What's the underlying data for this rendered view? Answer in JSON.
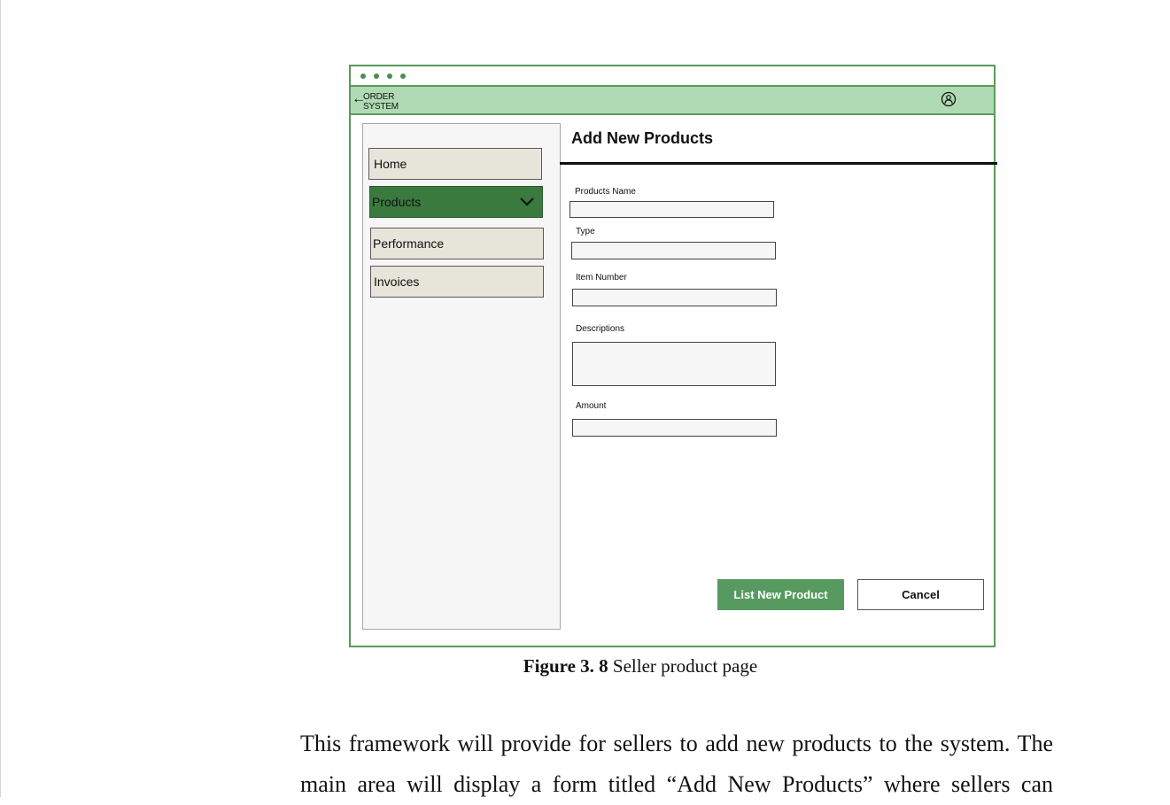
{
  "app": {
    "name_line1": "ORDER",
    "name_line2": "SYSTEM",
    "back_icon": "back-arrow-icon",
    "user_icon": "user-icon"
  },
  "sidebar": {
    "items": [
      {
        "label": "Home"
      },
      {
        "label": "Products",
        "active": true,
        "icon": "chevron-down-icon"
      },
      {
        "label": "Performance"
      },
      {
        "label": "Invoices"
      }
    ]
  },
  "form": {
    "title": "Add New Products",
    "fields": [
      {
        "label": "Products Name",
        "value": ""
      },
      {
        "label": "Type",
        "value": ""
      },
      {
        "label": "Item Number",
        "value": ""
      },
      {
        "label": "Descriptions",
        "value": ""
      },
      {
        "label": "Amount",
        "value": ""
      }
    ],
    "submit_label": "List New Product",
    "cancel_label": "Cancel"
  },
  "caption": {
    "number": "Figure 3. 8",
    "text": " Seller product page"
  },
  "paragraph": {
    "line1": "This framework will provide for sellers to add new products to the system. The",
    "line2": "main area will display a form titled “Add New Products” where sellers can"
  },
  "colors": {
    "accent_green": "#579a5f",
    "active_nav": "#3a7a3f",
    "appbar": "#b0dab3",
    "frame_border": "#5b9a5b"
  }
}
